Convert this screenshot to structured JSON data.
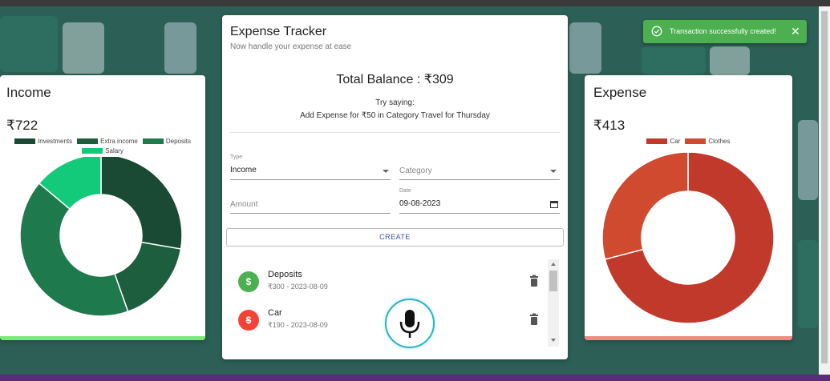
{
  "income_card": {
    "title": "Income",
    "amount": "₹722",
    "bar_color": "#7ae87a",
    "legend": [
      {
        "label": "Investments",
        "color": "#1a4a33"
      },
      {
        "label": "Extra income",
        "color": "#1d5e3e"
      },
      {
        "label": "Deposits",
        "color": "#1e7a4c"
      },
      {
        "label": "Salary",
        "color": "#13c97a"
      }
    ]
  },
  "expense_card": {
    "title": "Expense",
    "amount": "₹413",
    "bar_color": "#ef8b80",
    "legend": [
      {
        "label": "Car",
        "color": "#c0392b"
      },
      {
        "label": "Clothes",
        "color": "#cf4a2e"
      }
    ]
  },
  "chart_data": [
    {
      "type": "pie",
      "title": "",
      "donut": true,
      "categories": [
        "Investments",
        "Extra income",
        "Deposits",
        "Salary"
      ],
      "values": [
        200,
        122,
        300,
        100
      ],
      "colors": [
        "#1a4a33",
        "#1d5e3e",
        "#1e7a4c",
        "#13c97a"
      ]
    },
    {
      "type": "pie",
      "title": "",
      "donut": true,
      "categories": [
        "Car",
        "Clothes"
      ],
      "values": [
        293,
        120
      ],
      "colors": [
        "#c0392b",
        "#cf4a2e"
      ]
    }
  ],
  "tracker": {
    "title": "Expense Tracker",
    "subtitle": "Now handle your expense at ease",
    "balance": "Total Balance : ₹309",
    "try_saying": "Try saying:",
    "example": "Add Expense for ₹50 in Category Travel for Thursday",
    "type_label": "Type",
    "type_value": "Income",
    "category_placeholder": "Category",
    "amount_placeholder": "Amount",
    "date_label": "Date",
    "date_value": "09-08-2023",
    "create_label": "CREATE",
    "transactions": [
      {
        "name": "Deposits",
        "detail": "₹300 - 2023-08-09",
        "kind": "income",
        "color": "#4caf50"
      },
      {
        "name": "Car",
        "detail": "₹190 - 2023-08-09",
        "kind": "expense",
        "color": "#f44336"
      }
    ]
  },
  "toast": {
    "message": "Transaction successfully created!",
    "color": "#4caf50"
  }
}
